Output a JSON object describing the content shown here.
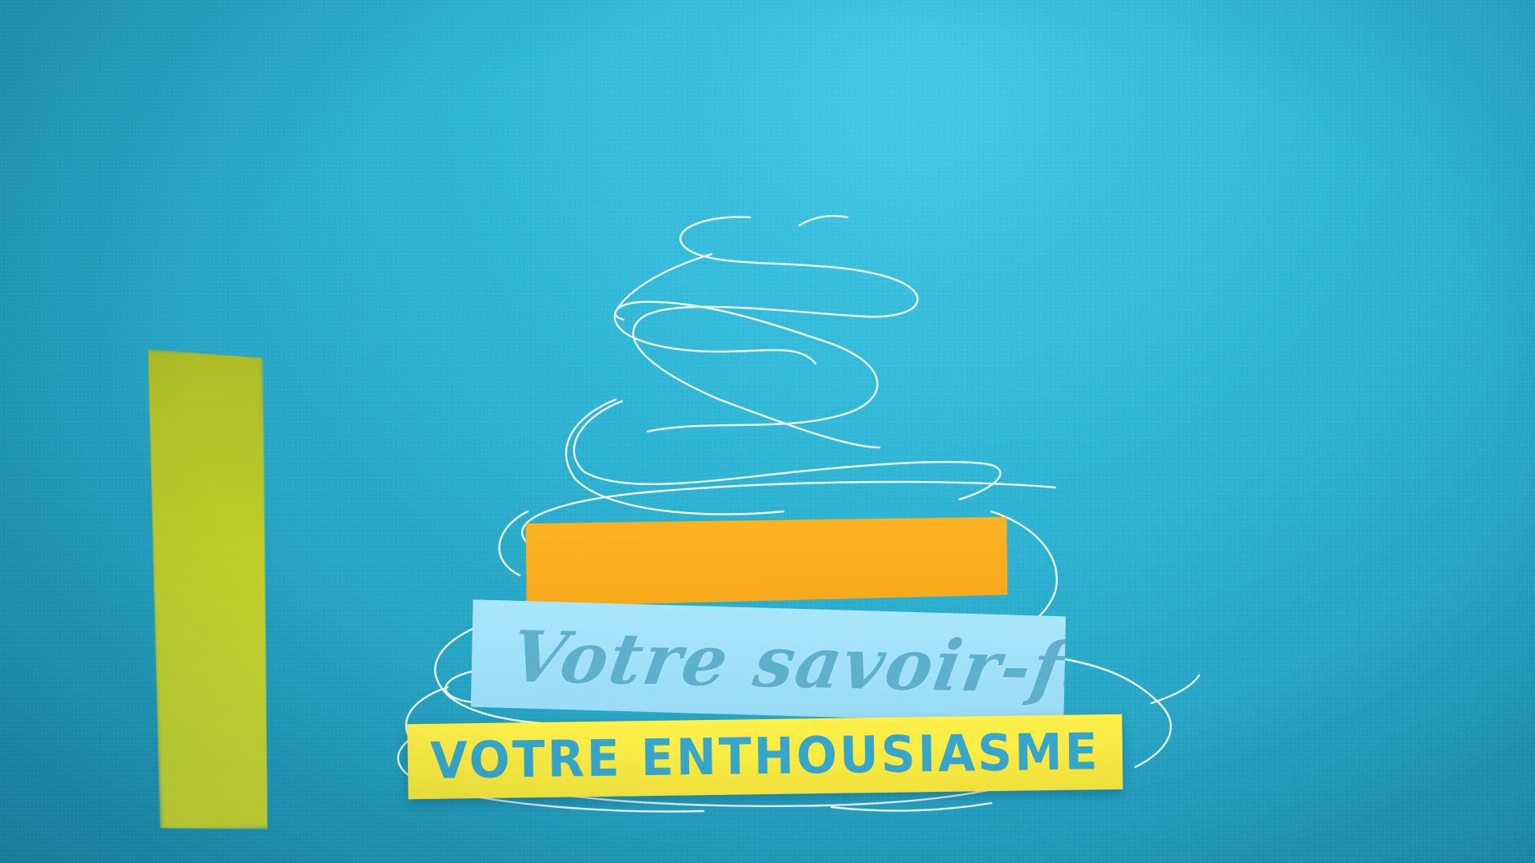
{
  "scene": {
    "background_color": "#2fb6d6",
    "scribble_color": "#ffffff"
  },
  "strips": {
    "orange": {
      "color": "#fcb322"
    },
    "blue": {
      "color": "#a8e6fb",
      "text": "Votre savoir-faire",
      "text_color": "#5aaec9"
    },
    "yellow": {
      "color": "#fff04a",
      "text": "VOTRE ENTHOUSIASME",
      "text_color": "#36a7cc"
    },
    "side_bar": {
      "color": "#c7cf22"
    }
  }
}
